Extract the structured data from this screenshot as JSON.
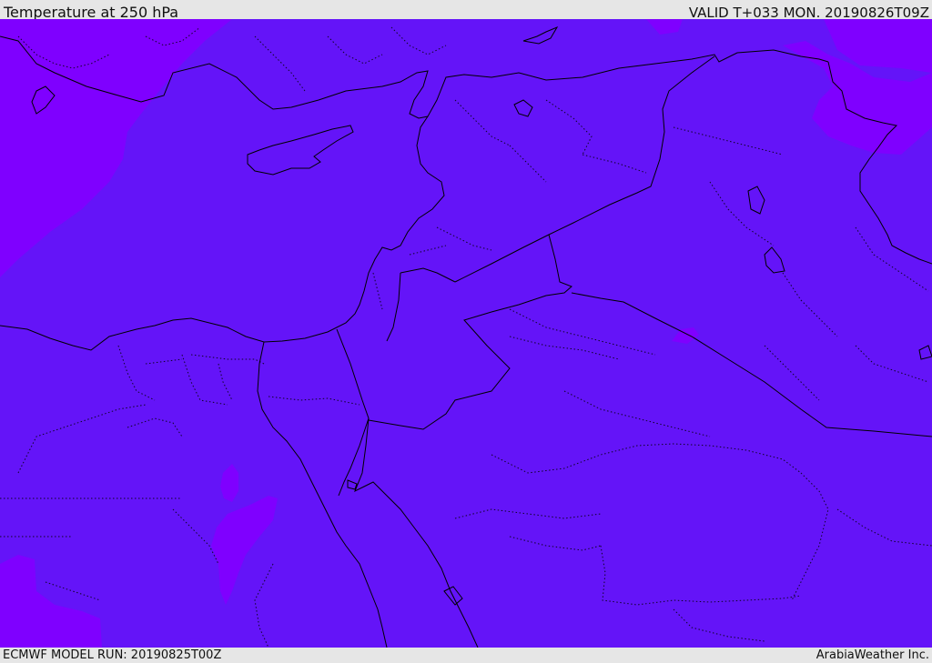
{
  "header": {
    "title": "Temperature at 250 hPa",
    "valid_time": "VALID T+033 MON. 20190826T09Z"
  },
  "footer": {
    "model_run": "ECMWF MODEL RUN: 20190825T00Z",
    "credit": "ArabiaWeather Inc."
  },
  "map": {
    "colors": {
      "field_main": "#6414f8",
      "field_warm": "#7f00ff",
      "boundary": "#000000"
    }
  }
}
